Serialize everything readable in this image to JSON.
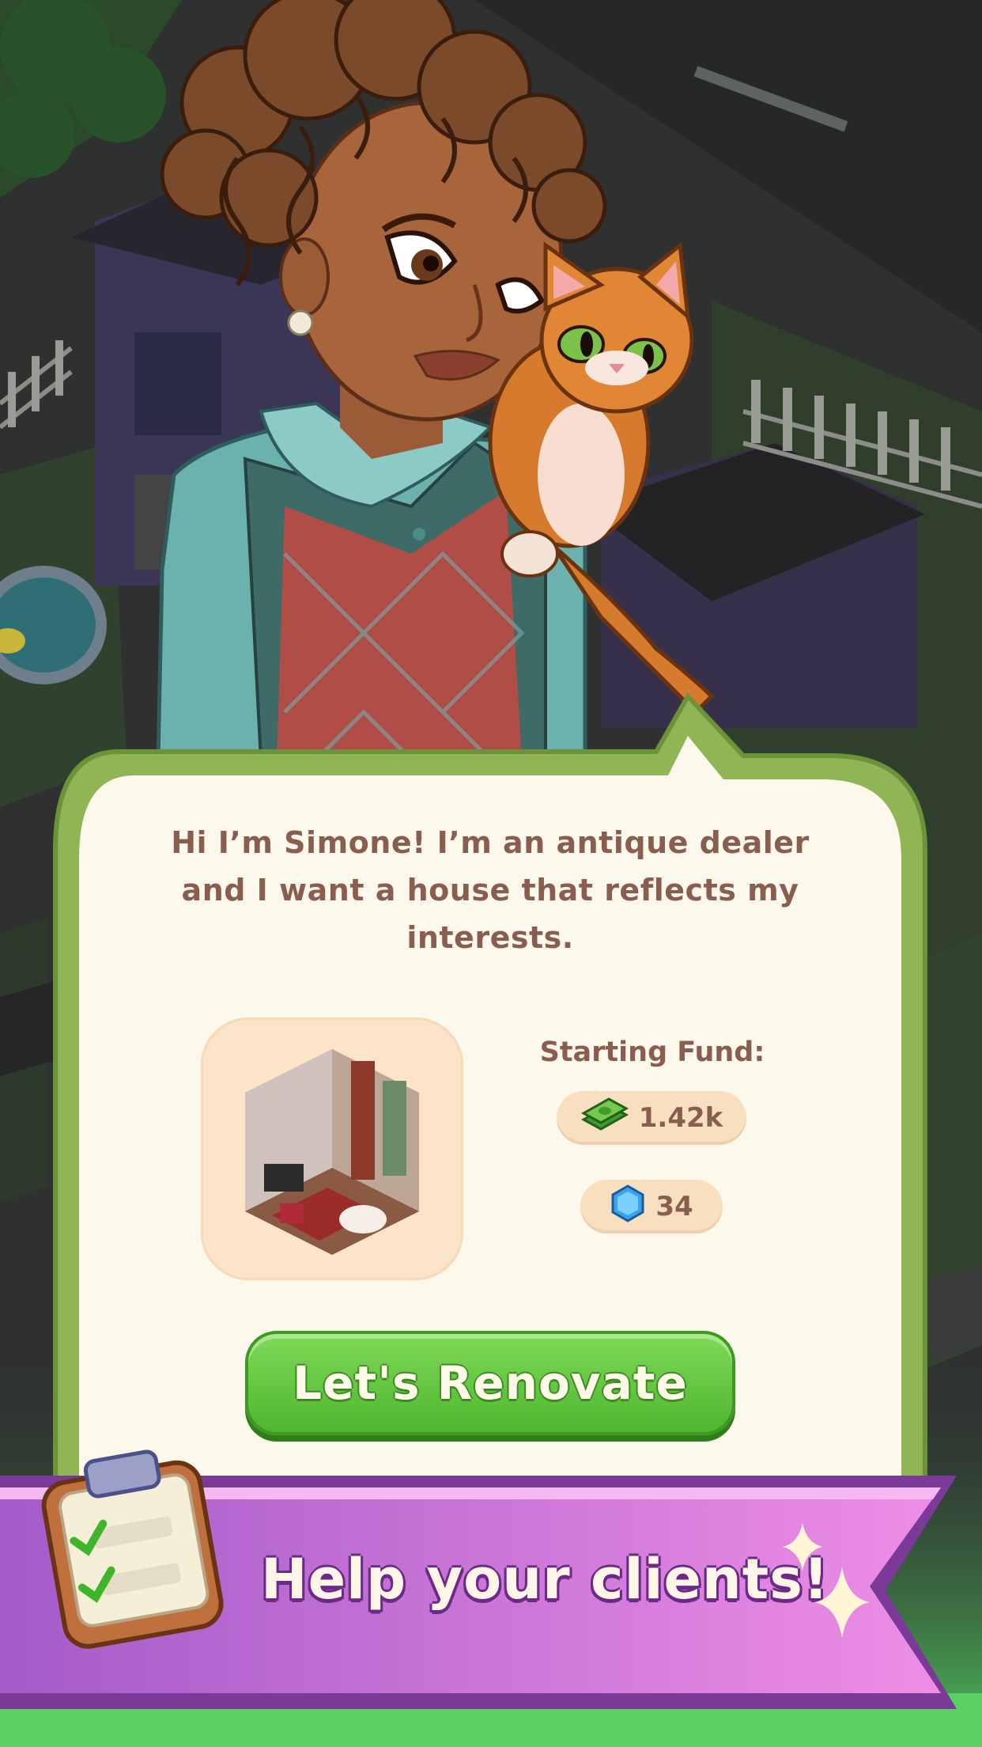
{
  "dialog": {
    "message": "Hi I’m Simone! I’m an antique dealer and I want a house that reflects my interests.",
    "fund_label": "Starting Fund:",
    "cash_amount": "1.42k",
    "gem_amount": "34",
    "button_label": "Let's Renovate"
  },
  "banner": {
    "text": "Help your clients!"
  },
  "icons": {
    "cash": "cash-stack-icon",
    "gem": "blue-gem-icon",
    "clipboard": "clipboard-checklist-icon",
    "sparkle": "sparkle-icon"
  },
  "colors": {
    "dialog_border": "#8fb555",
    "dialog_fill": "#fdf8ec",
    "button_green": "#5fc33a",
    "banner_purple": "#c46fe0",
    "text_brown": "#8a5e4f"
  }
}
